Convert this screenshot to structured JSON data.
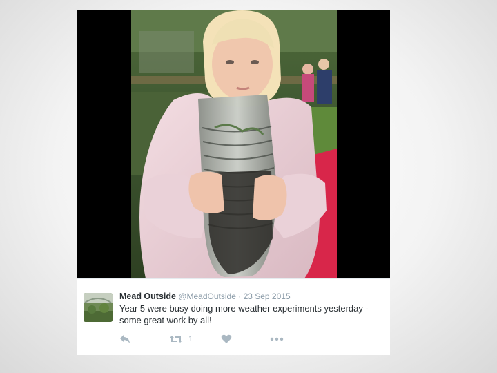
{
  "tweet": {
    "display_name": "Mead Outside",
    "handle": "@MeadOutside",
    "separator": "·",
    "date": "23 Sep 2015",
    "text_line1": "Year 5 were busy doing more weather experiments yesterday -",
    "text_line2": "some great work by all!",
    "retweet_count": "1"
  },
  "icons": {
    "reply": "reply-icon",
    "retweet": "retweet-icon",
    "like": "heart-icon",
    "more": "more-icon"
  },
  "colors": {
    "icon_gray": "#aab8c2",
    "meta_gray": "#8899a6",
    "text": "#292f33"
  }
}
